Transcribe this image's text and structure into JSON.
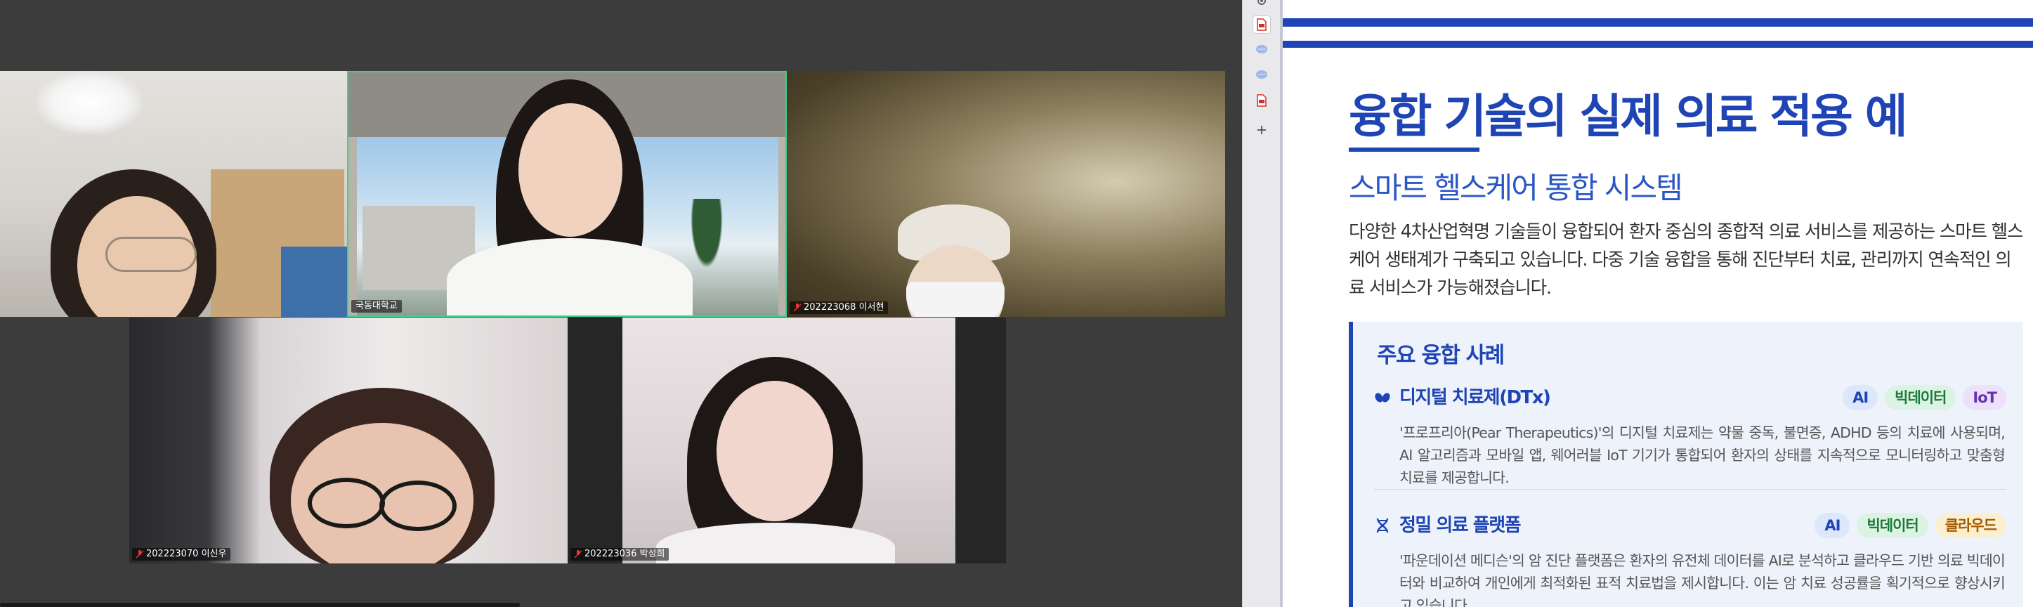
{
  "participants": [
    {
      "id": "p1",
      "name": ""
    },
    {
      "id": "p2",
      "name": "국동대학교"
    },
    {
      "id": "p3",
      "name": "202223068 이서현"
    },
    {
      "id": "p4",
      "name": "202223070 이신우"
    },
    {
      "id": "p5",
      "name": "202223036 박성희"
    }
  ],
  "side_strip": {
    "icons": [
      "settings-icon",
      "pdf-file-icon",
      "chat-bubble-icon",
      "chat-bubble-icon",
      "pdf-file-icon",
      "add-icon"
    ]
  },
  "slide": {
    "title": "융합 기술의 실제 의료 적용 예",
    "subtitle": "스마트 헬스케어 통합 시스템",
    "intro": "다양한 4차산업혁명 기술들이 융합되어 환자 중심의 종합적 의료 서비스를 제공하는 스마트 헬스케어 생태계가 구축되고 있습니다. 다중 기술 융합을 통해 진단부터 치료, 관리까지 연속적인 의료 서비스가 가능해졌습니다.",
    "cases_title": "주요 융합 사례",
    "cases": [
      {
        "title": "디지털 치료제(DTx)",
        "icon": "pills-icon",
        "tags": [
          "AI",
          "빅데이터",
          "IoT"
        ],
        "description": "'프로프리아(Pear Therapeutics)'의 디지털 치료제는 약물 중독, 불면증, ADHD 등의 치료에 사용되며, AI 알고리즘과 모바일 앱, 웨어러블 IoT 기기가 통합되어 환자의 상태를 지속적으로 모니터링하고 맞춤형 치료를 제공합니다."
      },
      {
        "title": "정밀 의료 플랫폼",
        "icon": "dna-icon",
        "tags": [
          "AI",
          "빅데이터",
          "클라우드"
        ],
        "description": "'파운데이션 메디슨'의 암 진단 플랫폼은 환자의 유전체 데이터를 AI로 분석하고 클라우드 기반 의료 빅데이터와 비교하여 개인에게 최적화된 표적 치료법을 제시합니다. 이는 암 치료 성공률을 획기적으로 향상시키고 있습니다."
      }
    ]
  },
  "colors": {
    "brand": "#1f45b5",
    "active_speaker": "#3fcf8e",
    "meeting_bg": "#3c3c3c"
  }
}
